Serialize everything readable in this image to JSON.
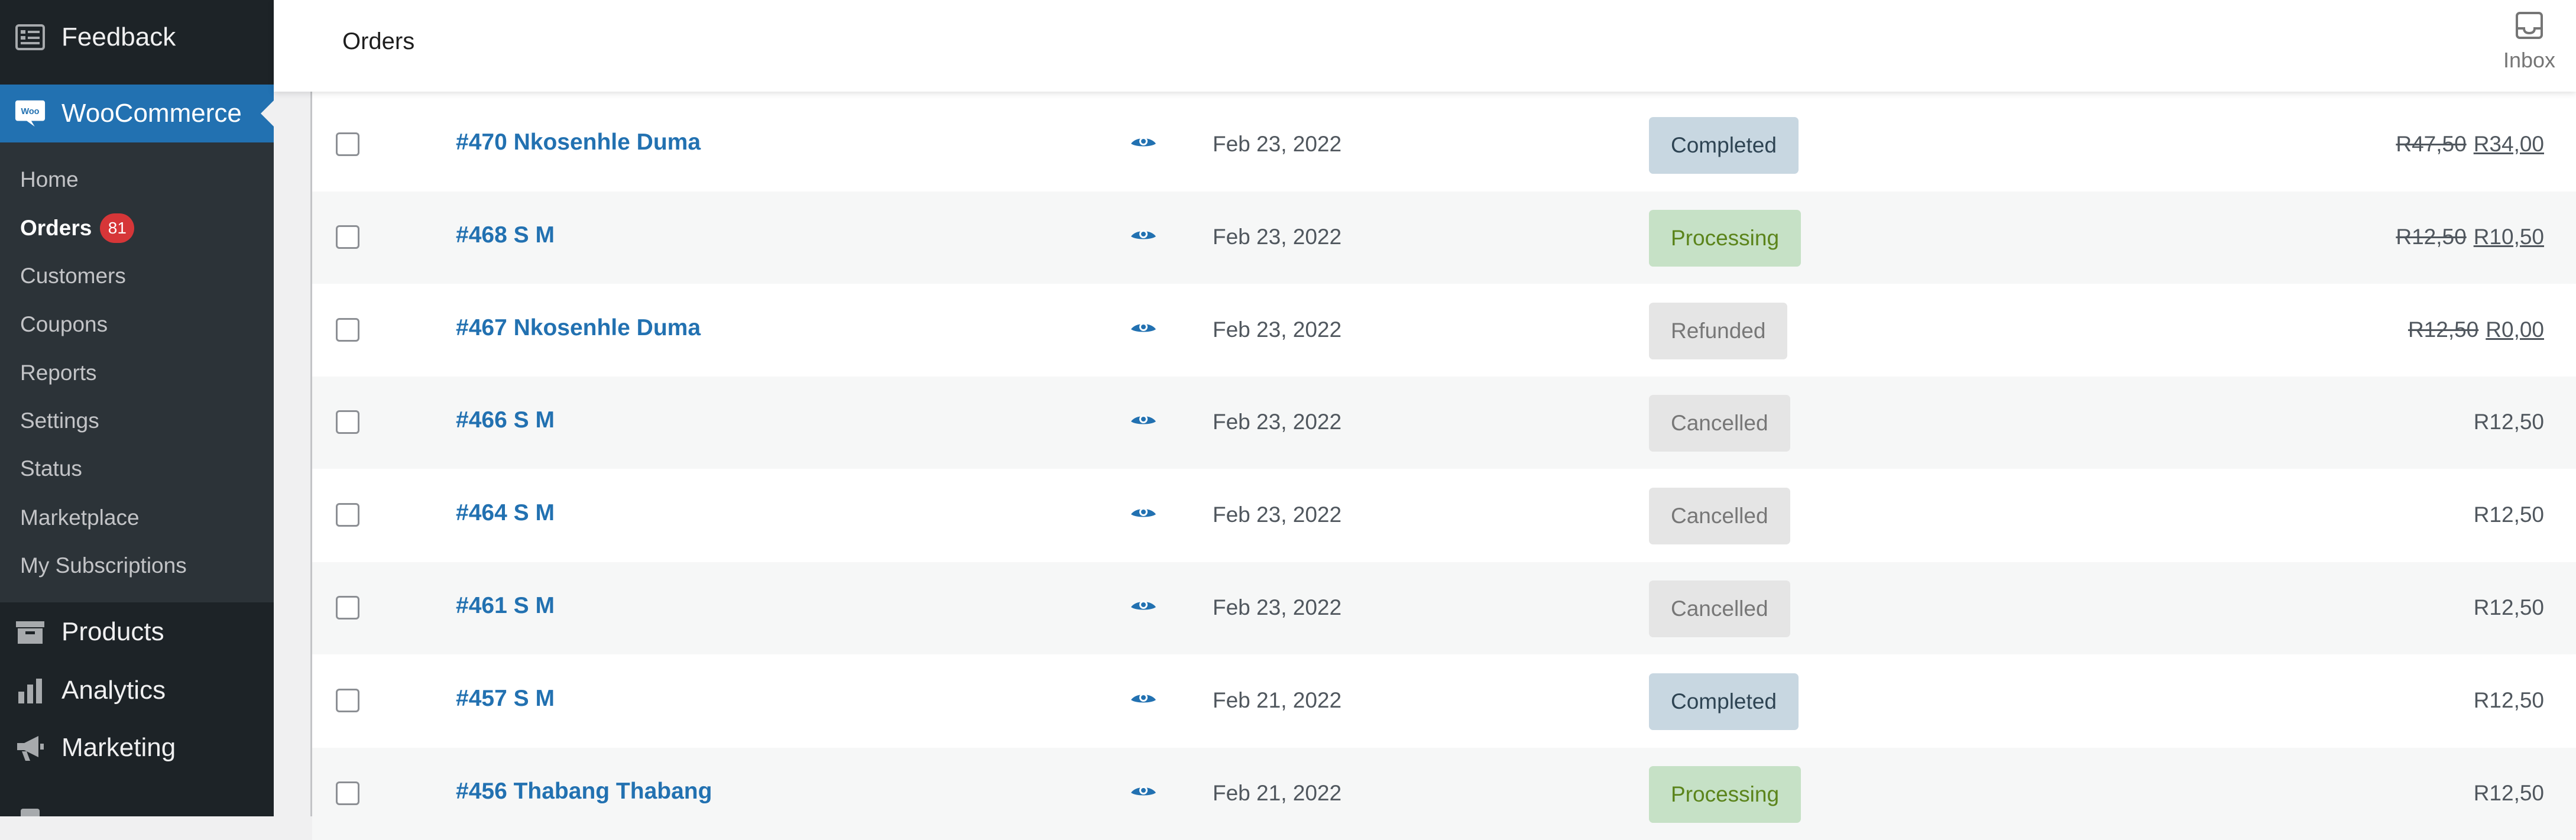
{
  "sidebar": {
    "feedback": {
      "label": "Feedback",
      "icon": "feedback-icon"
    },
    "woocommerce": {
      "label": "WooCommerce",
      "icon": "woo-logo-icon",
      "icon_text": "Woo"
    },
    "submenu": [
      {
        "label": "Home",
        "current": false
      },
      {
        "label": "Orders",
        "current": true,
        "badge": "81"
      },
      {
        "label": "Customers",
        "current": false
      },
      {
        "label": "Coupons",
        "current": false
      },
      {
        "label": "Reports",
        "current": false
      },
      {
        "label": "Settings",
        "current": false
      },
      {
        "label": "Status",
        "current": false
      },
      {
        "label": "Marketplace",
        "current": false
      },
      {
        "label": "My Subscriptions",
        "current": false
      }
    ],
    "products": {
      "label": "Products",
      "icon": "archive-icon"
    },
    "analytics": {
      "label": "Analytics",
      "icon": "bar-chart-icon"
    },
    "marketing": {
      "label": "Marketing",
      "icon": "megaphone-icon"
    }
  },
  "header": {
    "title": "Orders",
    "inbox_label": "Inbox"
  },
  "orders": [
    {
      "number": "#470 Nkosenhle Duma",
      "date": "Feb 23, 2022",
      "status": "Completed",
      "status_class": "st-completed",
      "original_total": "R47,50",
      "total": "R34,00"
    },
    {
      "number": "#468 S M",
      "date": "Feb 23, 2022",
      "status": "Processing",
      "status_class": "st-processing",
      "original_total": "R12,50",
      "total": "R10,50"
    },
    {
      "number": "#467 Nkosenhle Duma",
      "date": "Feb 23, 2022",
      "status": "Refunded",
      "status_class": "st-refunded",
      "original_total": "R12,50",
      "total": "R0,00"
    },
    {
      "number": "#466 S M",
      "date": "Feb 23, 2022",
      "status": "Cancelled",
      "status_class": "st-cancelled",
      "original_total": "",
      "total": "R12,50"
    },
    {
      "number": "#464 S M",
      "date": "Feb 23, 2022",
      "status": "Cancelled",
      "status_class": "st-cancelled",
      "original_total": "",
      "total": "R12,50"
    },
    {
      "number": "#461 S M",
      "date": "Feb 23, 2022",
      "status": "Cancelled",
      "status_class": "st-cancelled",
      "original_total": "",
      "total": "R12,50"
    },
    {
      "number": "#457 S M",
      "date": "Feb 21, 2022",
      "status": "Completed",
      "status_class": "st-completed",
      "original_total": "",
      "total": "R12,50"
    },
    {
      "number": "#456 Thabang Thabang",
      "date": "Feb 21, 2022",
      "status": "Processing",
      "status_class": "st-processing",
      "original_total": "",
      "total": "R12,50"
    }
  ],
  "colors": {
    "admin_sidebar": "#1d2327",
    "submenu_bg": "#2c3338",
    "accent": "#2271b1",
    "badge": "#d63638"
  }
}
